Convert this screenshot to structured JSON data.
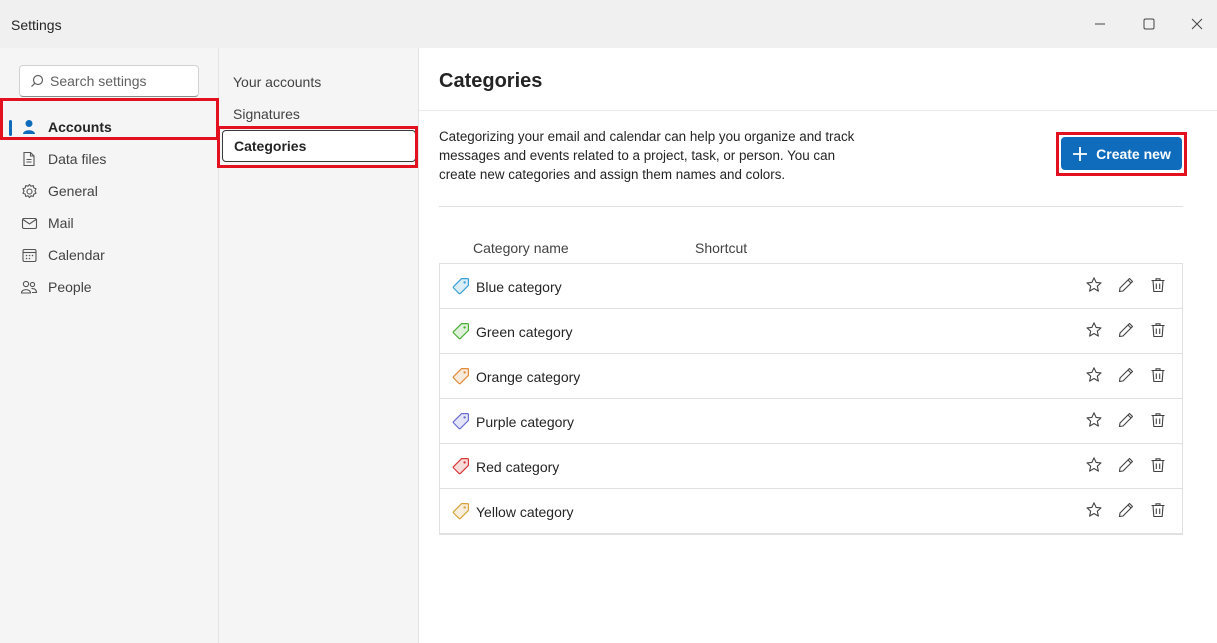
{
  "window": {
    "title": "Settings"
  },
  "search": {
    "placeholder": "Search settings"
  },
  "nav": {
    "items": [
      {
        "label": "Accounts",
        "icon": "person-icon",
        "active": true
      },
      {
        "label": "Data files",
        "icon": "document-icon"
      },
      {
        "label": "General",
        "icon": "gear-icon"
      },
      {
        "label": "Mail",
        "icon": "mail-icon"
      },
      {
        "label": "Calendar",
        "icon": "calendar-icon"
      },
      {
        "label": "People",
        "icon": "people-icon"
      }
    ]
  },
  "subnav": {
    "items": [
      {
        "label": "Your accounts"
      },
      {
        "label": "Signatures"
      },
      {
        "label": "Categories",
        "active": true
      }
    ]
  },
  "main": {
    "heading": "Categories",
    "description": "Categorizing your email and calendar can help you organize and track messages and events related to a project, task, or person. You can create new categories and assign them names and colors.",
    "create_label": "Create new",
    "columns": {
      "name": "Category name",
      "shortcut": "Shortcut"
    },
    "categories": [
      {
        "name": "Blue category",
        "color": "#3aa0d6"
      },
      {
        "name": "Green category",
        "color": "#4caf3a"
      },
      {
        "name": "Orange category",
        "color": "#e08a3a"
      },
      {
        "name": "Purple category",
        "color": "#6b6fd6"
      },
      {
        "name": "Red category",
        "color": "#d93838"
      },
      {
        "name": "Yellow category",
        "color": "#d9a23a"
      }
    ]
  },
  "colors": {
    "accent": "#0f6cbd",
    "highlight": "#e3101f"
  }
}
